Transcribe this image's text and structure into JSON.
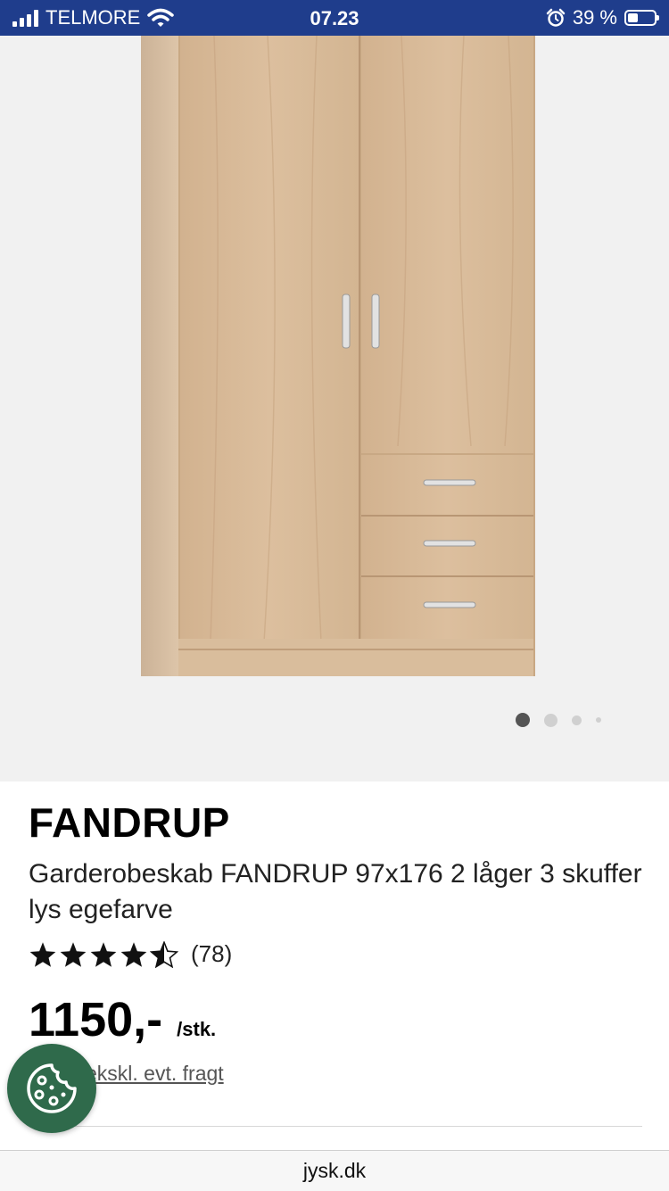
{
  "status_bar": {
    "carrier": "TELMORE",
    "time": "07.23",
    "battery": "39 %",
    "battery_level": 0.39
  },
  "gallery": {
    "image_alt": "Garderobeskab FANDRUP",
    "slide_count": 4,
    "active_slide": 1
  },
  "product": {
    "name": "FANDRUP",
    "description": "Garderobeskab FANDRUP 97x176 2 låger 3 skuffer lys egefarve",
    "rating": 4.5,
    "rating_max": 5,
    "review_count": "(78)",
    "price": "1150,-",
    "unit": "/stk.",
    "freight_link": "ekskl. evt. fragt"
  },
  "colors": {
    "status_bar": "#1f3d8c",
    "cookie_button": "#2f6a4b",
    "wood": "#d6b894"
  },
  "icons": {
    "signal": "signal-icon",
    "wifi": "wifi-icon",
    "alarm": "alarm-icon",
    "battery": "battery-icon",
    "star": "star-icon",
    "cookie": "cookie-icon"
  },
  "browser": {
    "url": "jysk.dk"
  }
}
